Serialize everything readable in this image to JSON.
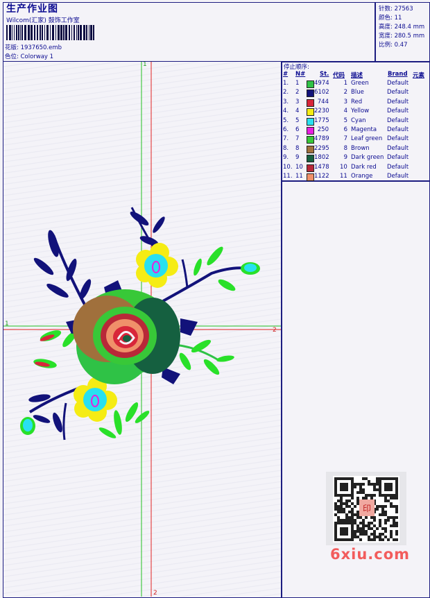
{
  "header": {
    "title": "生产作业图",
    "company": "Wilcom(汇家) 鼓饰工作室",
    "design_label": "花版:",
    "design_value": "1937650.emb",
    "colorway_label": "色位:",
    "colorway_value": "Colorway 1"
  },
  "stats": [
    {
      "label": "针数:",
      "value": "27563"
    },
    {
      "label": "颜色:",
      "value": "11"
    },
    {
      "label": "高度:",
      "value": "248.4 mm"
    },
    {
      "label": "宽度:",
      "value": "280.5 mm"
    },
    {
      "label": "比例:",
      "value": "0.47"
    }
  ],
  "stop_sequence": {
    "title": "停止顺序:",
    "headers": [
      "#",
      "N#",
      "St.",
      "代码",
      "描述",
      "Brand",
      "元素"
    ],
    "rows": [
      {
        "idx": "1.",
        "n": "1",
        "color": "#2fc246",
        "st": "4974",
        "code": "1",
        "desc": "Green",
        "brand": "Default"
      },
      {
        "idx": "2.",
        "n": "2",
        "color": "#12127a",
        "st": "6102",
        "code": "2",
        "desc": "Blue",
        "brand": "Default"
      },
      {
        "idx": "3.",
        "n": "3",
        "color": "#d8263a",
        "st": "744",
        "code": "3",
        "desc": "Red",
        "brand": "Default"
      },
      {
        "idx": "4.",
        "n": "4",
        "color": "#f5ec14",
        "st": "2230",
        "code": "4",
        "desc": "Yellow",
        "brand": "Default"
      },
      {
        "idx": "5.",
        "n": "5",
        "color": "#28e0f0",
        "st": "1775",
        "code": "5",
        "desc": "Cyan",
        "brand": "Default"
      },
      {
        "idx": "6.",
        "n": "6",
        "color": "#e81ee0",
        "st": "250",
        "code": "6",
        "desc": "Magenta",
        "brand": "Default"
      },
      {
        "idx": "7.",
        "n": "7",
        "color": "#38c838",
        "st": "4789",
        "code": "7",
        "desc": "Leaf green",
        "brand": "Default"
      },
      {
        "idx": "8.",
        "n": "8",
        "color": "#a0703c",
        "st": "2295",
        "code": "8",
        "desc": "Brown",
        "brand": "Default"
      },
      {
        "idx": "9.",
        "n": "9",
        "color": "#156040",
        "st": "1802",
        "code": "9",
        "desc": "Dark green",
        "brand": "Default"
      },
      {
        "idx": "10.",
        "n": "10",
        "color": "#b82838",
        "st": "1478",
        "code": "10",
        "desc": "Dark red",
        "brand": "Default"
      },
      {
        "idx": "11.",
        "n": "11",
        "color": "#f0906a",
        "st": "1122",
        "code": "11",
        "desc": "Orange",
        "brand": "Default"
      }
    ]
  },
  "guides": {
    "h_start": "1",
    "h_end": "2",
    "v_start": "1",
    "v_end": "2"
  },
  "watermark": "6xiu.com",
  "seal_text": "印"
}
